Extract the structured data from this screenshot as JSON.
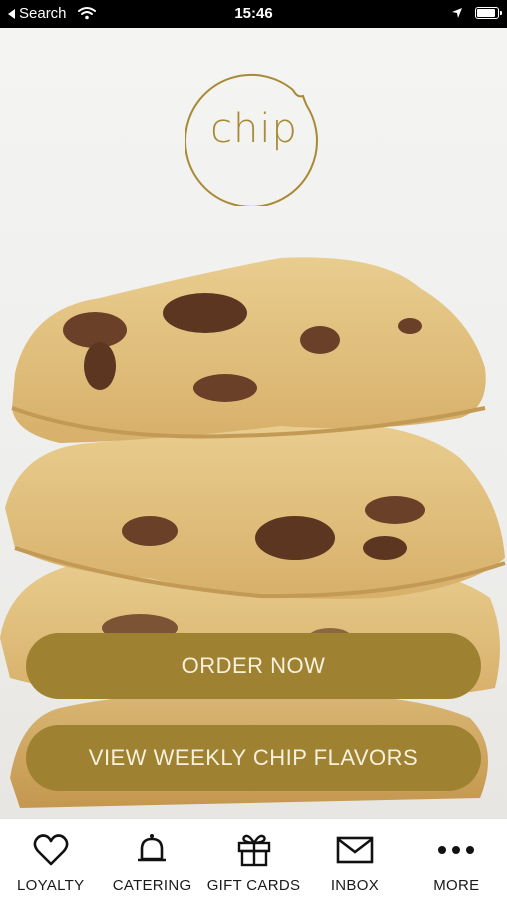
{
  "status_bar": {
    "back_label": "Search",
    "time": "15:46",
    "icons": [
      "wifi-icon",
      "location-arrow-icon",
      "battery-icon"
    ]
  },
  "brand": {
    "logo_text": "chip",
    "accent_color": "#9e8232",
    "logo_color": "#a88a36"
  },
  "hero": {
    "image": "stacked-chocolate-chip-cookies-photo"
  },
  "actions": {
    "order_label": "ORDER NOW",
    "flavors_label": "VIEW WEEKLY CHIP FLAVORS"
  },
  "nav": {
    "items": [
      {
        "label": "LOYALTY",
        "icon": "heart-icon"
      },
      {
        "label": "CATERING",
        "icon": "bell-icon"
      },
      {
        "label": "GIFT CARDS",
        "icon": "gift-icon"
      },
      {
        "label": "INBOX",
        "icon": "envelope-icon"
      },
      {
        "label": "MORE",
        "icon": "more-dots-icon"
      }
    ]
  }
}
